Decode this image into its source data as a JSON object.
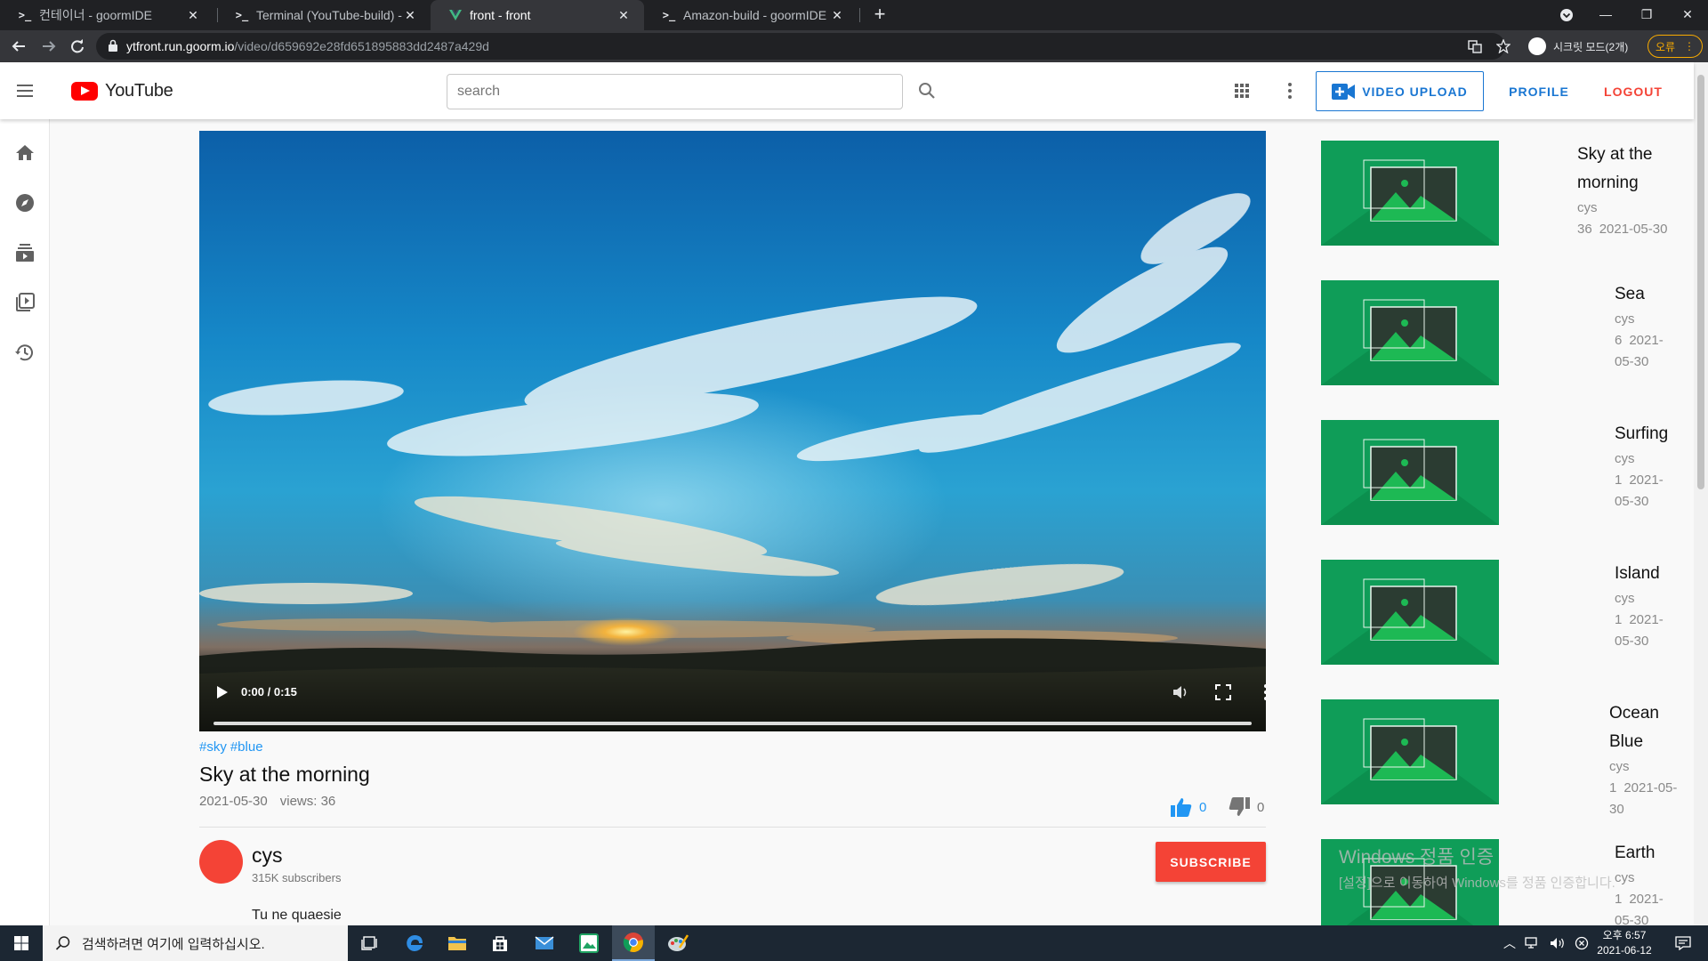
{
  "browser": {
    "tabs": [
      {
        "label": "컨테이너 - goormIDE",
        "icon": "terminal-icon",
        "active": false
      },
      {
        "label": "Terminal (YouTube-build) - goo",
        "icon": "terminal-icon",
        "active": false
      },
      {
        "label": "front - front",
        "icon": "vue-icon",
        "active": true
      },
      {
        "label": "Amazon-build - goormIDE",
        "icon": "terminal-icon",
        "active": false
      }
    ],
    "url_host": "ytfront.run.goorm.io",
    "url_path": "/video/d659692e28fd651895883dd2487a429d",
    "incognito_label": "시크릿 모드(2개)",
    "error_label": "오류"
  },
  "header": {
    "logo_text": "YouTube",
    "search_placeholder": "search",
    "upload_label": "VIDEO UPLOAD",
    "profile_label": "PROFILE",
    "logout_label": "LOGOUT"
  },
  "sidebar": {
    "items": [
      {
        "icon": "home-icon"
      },
      {
        "icon": "explore-icon"
      },
      {
        "icon": "subscriptions-icon"
      },
      {
        "icon": "library-icon"
      },
      {
        "icon": "history-icon"
      }
    ]
  },
  "video": {
    "time": "0:00 / 0:15",
    "progress": 0,
    "tags": [
      "#sky",
      "#blue"
    ],
    "title": "Sky at the morning",
    "date": "2021-05-30",
    "views": "views: 36",
    "likes": "0",
    "dislikes": "0",
    "channel_name": "cys",
    "subscribers": "315K subscribers",
    "subscribe_label": "SUBSCRIBE",
    "description": "Tu ne quaesie"
  },
  "related": [
    {
      "title_lines": [
        "Sky at the",
        "morning"
      ],
      "channel": "cys",
      "meta_lines": [
        [
          "36",
          "2021-05-30"
        ]
      ]
    },
    {
      "title_lines": [
        "Sea"
      ],
      "channel": "cys",
      "meta_lines": [
        [
          "6",
          "2021-"
        ],
        [
          "05-30"
        ]
      ]
    },
    {
      "title_lines": [
        "Surfing"
      ],
      "channel": "cys",
      "meta_lines": [
        [
          "1",
          "2021-"
        ],
        [
          "05-30"
        ]
      ]
    },
    {
      "title_lines": [
        "Island"
      ],
      "channel": "cys",
      "meta_lines": [
        [
          "1",
          "2021-"
        ],
        [
          "05-30"
        ]
      ]
    },
    {
      "title_lines": [
        "Ocean",
        "Blue"
      ],
      "channel": "cys",
      "meta_lines": [
        [
          "1",
          "2021-05-"
        ],
        [
          "30"
        ]
      ]
    },
    {
      "title_lines": [
        "Earth"
      ],
      "channel": "cys",
      "meta_lines": [
        [
          "1",
          "2021-"
        ],
        [
          "05-30"
        ]
      ]
    }
  ],
  "watermark": {
    "line1": "Windows 정품 인증",
    "line2": "[설정]으로 이동하여 Windows를 정품 인증합니다."
  },
  "taskbar": {
    "search_placeholder": "검색하려면 여기에 입력하십시오.",
    "time": "오후 6:57",
    "date": "2021-06-12"
  },
  "colors": {
    "accent_blue": "#1976d2",
    "link_blue": "#2196f3",
    "danger_red": "#f44336",
    "thumb_green": "#0f9d58"
  }
}
